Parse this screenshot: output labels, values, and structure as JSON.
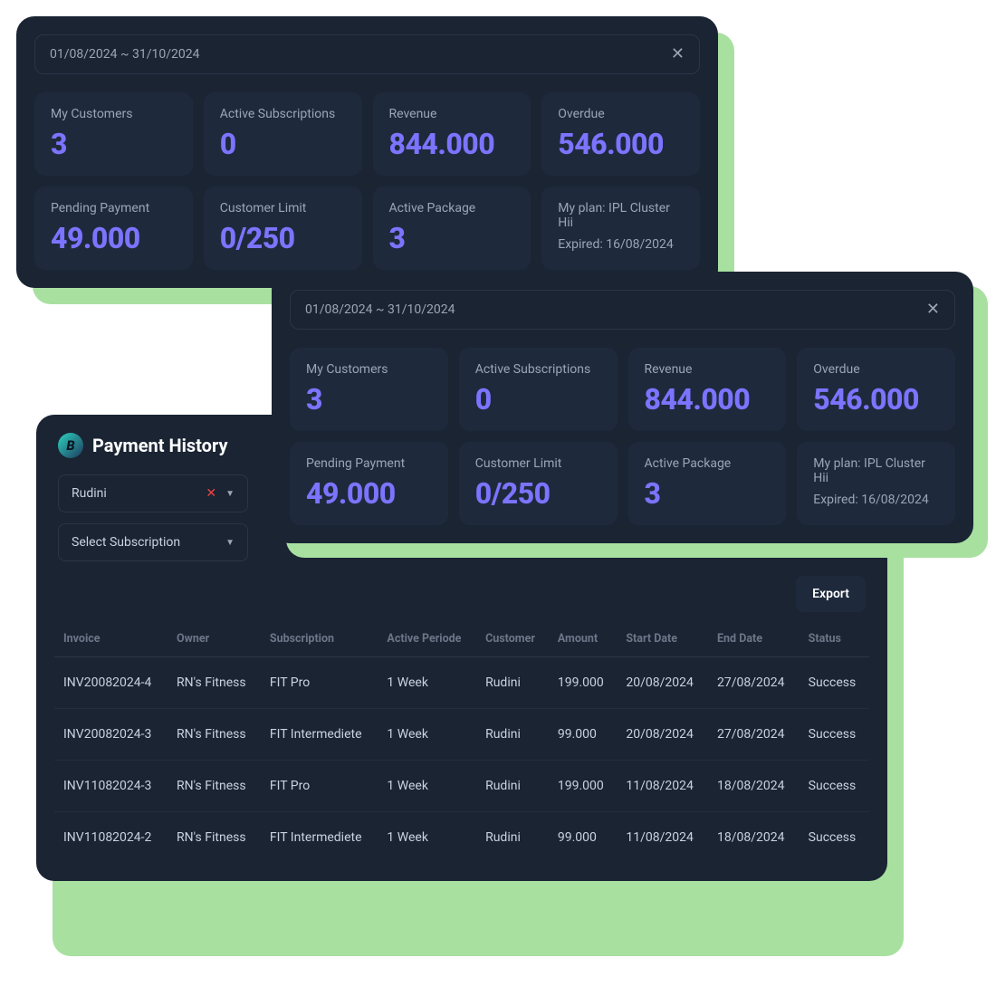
{
  "date_range": "01/08/2024 ~ 31/10/2024",
  "stats": {
    "my_customers_label": "My Customers",
    "my_customers": "3",
    "active_subs_label": "Active Subscriptions",
    "active_subs": "0",
    "revenue_label": "Revenue",
    "revenue": "844.000",
    "overdue_label": "Overdue",
    "overdue": "546.000",
    "pending_label": "Pending Payment",
    "pending": "49.000",
    "limit_label": "Customer Limit",
    "limit": "0/250",
    "active_pkg_label": "Active Package",
    "active_pkg": "3",
    "plan_line1": "My plan: IPL Cluster Hii",
    "plan_line2": "Expired: 16/08/2024"
  },
  "payment_history": {
    "title": "Payment History",
    "customer_select": "Rudini",
    "subscription_select": "Select Subscription",
    "export_label": "Export",
    "columns": [
      "Invoice",
      "Owner",
      "Subscription",
      "Active Periode",
      "Customer",
      "Amount",
      "Start Date",
      "End Date",
      "Status"
    ],
    "rows": [
      {
        "invoice": "INV20082024-4",
        "owner": "RN's Fitness",
        "sub": "FIT Pro",
        "period": "1 Week",
        "customer": "Rudini",
        "amount": "199.000",
        "start": "20/08/2024",
        "end": "27/08/2024",
        "status": "Success"
      },
      {
        "invoice": "INV20082024-3",
        "owner": "RN's Fitness",
        "sub": "FIT Intermediete",
        "period": "1 Week",
        "customer": "Rudini",
        "amount": "99.000",
        "start": "20/08/2024",
        "end": "27/08/2024",
        "status": "Success"
      },
      {
        "invoice": "INV11082024-3",
        "owner": "RN's Fitness",
        "sub": "FIT Pro",
        "period": "1 Week",
        "customer": "Rudini",
        "amount": "199.000",
        "start": "11/08/2024",
        "end": "18/08/2024",
        "status": "Success"
      },
      {
        "invoice": "INV11082024-2",
        "owner": "RN's Fitness",
        "sub": "FIT Intermediete",
        "period": "1 Week",
        "customer": "Rudini",
        "amount": "99.000",
        "start": "11/08/2024",
        "end": "18/08/2024",
        "status": "Success"
      }
    ]
  }
}
